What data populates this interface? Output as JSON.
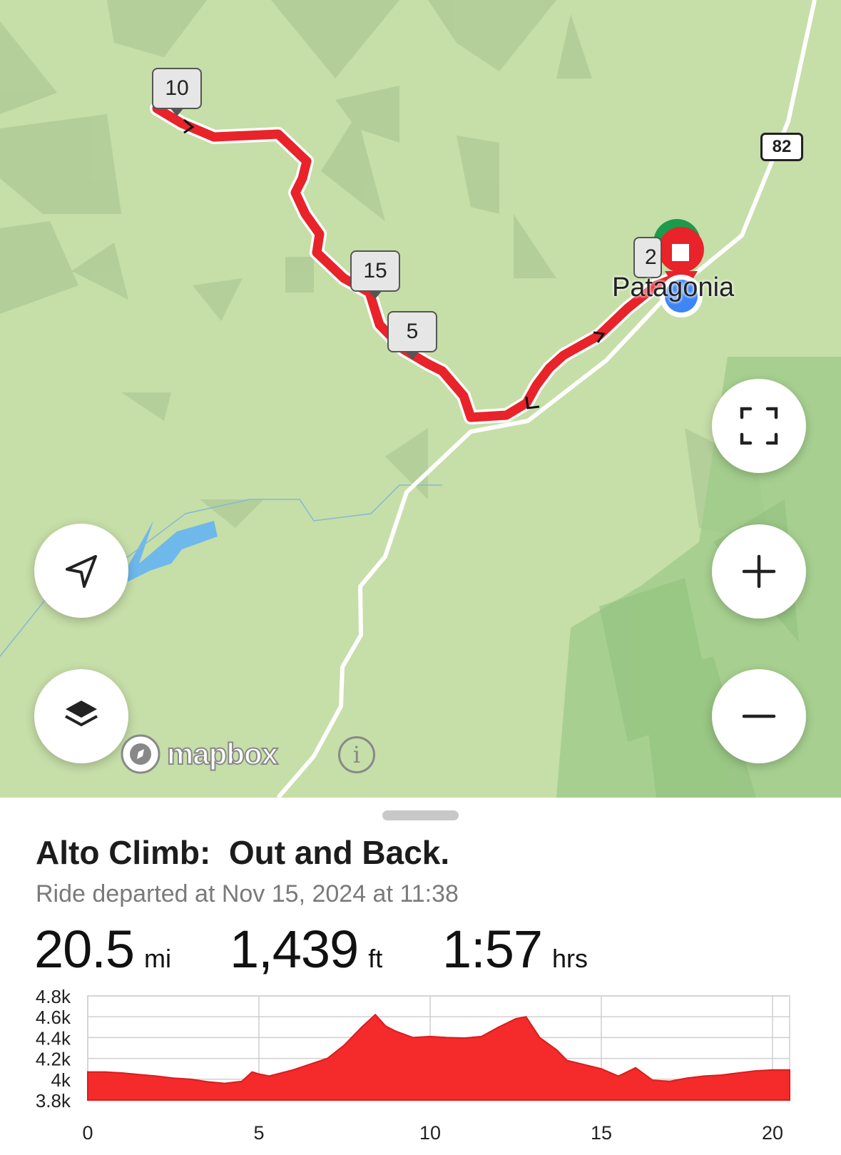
{
  "map": {
    "route_markers": [
      "10",
      "15",
      "5",
      "2"
    ],
    "town_name": "Patagonia",
    "highway_shield": "82",
    "attribution": "mapbox",
    "buttons": {
      "locate": "location-arrow-icon",
      "layers": "layers-icon",
      "fullscreen": "fullscreen-icon",
      "zoom_in": "plus-icon",
      "zoom_out": "minus-icon",
      "info": "i"
    },
    "colors": {
      "route": "#e8232a",
      "start_marker": "#1d9a4c",
      "end_marker": "#e8232a",
      "current_location": "#3e86f5",
      "water": "#6eb8ec",
      "land": "#c6dea8"
    }
  },
  "ride": {
    "title": "Alto Climb:  Out and Back.",
    "subtitle": "Ride departed at Nov 15, 2024 at 11:38",
    "distance_value": "20.5",
    "distance_unit": "mi",
    "elevation_value": "1,439",
    "elevation_unit": "ft",
    "duration_value": "1:57",
    "duration_unit": "hrs"
  },
  "chart_data": {
    "type": "area",
    "x": [
      0,
      0.5,
      1,
      1.5,
      2,
      2.5,
      3,
      3.5,
      4,
      4.5,
      4.8,
      5,
      5.3,
      6,
      7,
      7.5,
      8,
      8.4,
      8.7,
      9,
      9.5,
      10,
      10.5,
      11,
      11.5,
      12,
      12.5,
      12.8,
      13.2,
      13.7,
      14,
      15,
      15.5,
      16,
      16.5,
      17,
      17.5,
      18,
      18.5,
      19,
      19.5,
      20,
      20.5
    ],
    "y": [
      4070,
      4070,
      4060,
      4045,
      4030,
      4010,
      4000,
      3975,
      3960,
      3980,
      4070,
      4050,
      4030,
      4090,
      4200,
      4330,
      4500,
      4620,
      4510,
      4460,
      4400,
      4410,
      4400,
      4395,
      4410,
      4500,
      4580,
      4600,
      4400,
      4280,
      4180,
      4100,
      4030,
      4110,
      3990,
      3980,
      4010,
      4030,
      4040,
      4060,
      4080,
      4090,
      4090
    ],
    "xlim": [
      0,
      20.5
    ],
    "ylim": [
      3800,
      4800
    ],
    "x_ticks": [
      "0",
      "5",
      "10",
      "15",
      "20"
    ],
    "x_tick_values": [
      0,
      5,
      10,
      15,
      20
    ],
    "y_ticks": [
      "4.8k",
      "4.6k",
      "4.4k",
      "4.2k",
      "4k",
      "3.8k"
    ],
    "y_tick_values": [
      4800,
      4600,
      4400,
      4200,
      4000,
      3800
    ],
    "grid": true,
    "fill_color": "#f52a2a",
    "title": "",
    "xlabel": "",
    "ylabel": ""
  }
}
